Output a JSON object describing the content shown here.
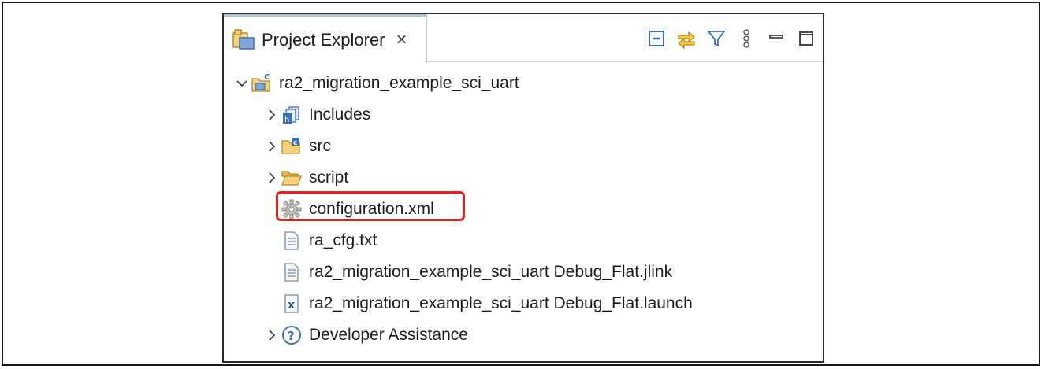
{
  "view": {
    "title": "Project Explorer",
    "close_glyph": "×"
  },
  "toolbar": {
    "icons": [
      "collapse-all-icon",
      "link-with-editor-icon",
      "filter-icon",
      "view-menu-icon",
      "minimize-icon",
      "maximize-icon"
    ]
  },
  "tree": {
    "project": "ra2_migration_example_sci_uart",
    "items": [
      {
        "label": "Includes",
        "icon": "includes-icon",
        "expandable": true
      },
      {
        "label": "src",
        "icon": "source-folder-icon",
        "expandable": true
      },
      {
        "label": "script",
        "icon": "folder-icon",
        "expandable": true
      },
      {
        "label": "configuration.xml",
        "icon": "gear-file-icon",
        "expandable": false,
        "highlighted": true
      },
      {
        "label": "ra_cfg.txt",
        "icon": "text-file-icon",
        "expandable": false
      },
      {
        "label": "ra2_migration_example_sci_uart Debug_Flat.jlink",
        "icon": "text-file-icon",
        "expandable": false
      },
      {
        "label": "ra2_migration_example_sci_uart Debug_Flat.launch",
        "icon": "launch-file-icon",
        "expandable": false
      },
      {
        "label": "Developer Assistance",
        "icon": "help-icon",
        "expandable": true
      }
    ]
  },
  "colors": {
    "highlight": "#e0221f",
    "folder": "#e8b84a",
    "accent_blue": "#3d6fb6"
  }
}
